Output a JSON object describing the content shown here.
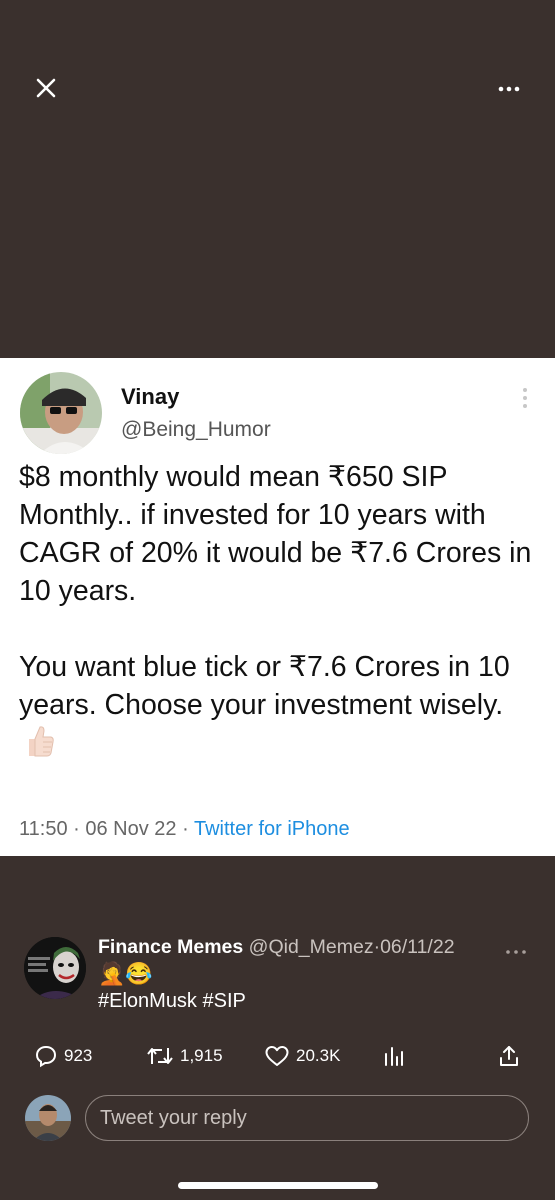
{
  "tweet": {
    "name": "Vinay",
    "handle": "@Being_Humor",
    "body": "$8 monthly would mean ₹650 SIP Monthly.. if invested for 10 years with CAGR of 20% it would be ₹7.6 Crores in 10 years.\n\nYou want blue tick or ₹7.6 Crores in 10 years. Choose your investment wisely.",
    "time": "11:50",
    "date": "06 Nov 22",
    "source": "Twitter for iPhone",
    "sep": "·"
  },
  "quote": {
    "name": "Finance Memes",
    "handle": "@Qid_Memez",
    "sep": "·",
    "date": "06/11/22",
    "emoji": "🤦😂",
    "hashtags": "#ElonMusk #SIP"
  },
  "actions": {
    "replies": "923",
    "retweets": "1,915",
    "likes": "20.3K"
  },
  "reply": {
    "placeholder": "Tweet your reply"
  },
  "colors": {
    "background": "#3a302d",
    "card": "#ffffff",
    "link": "#1d8ee0"
  }
}
